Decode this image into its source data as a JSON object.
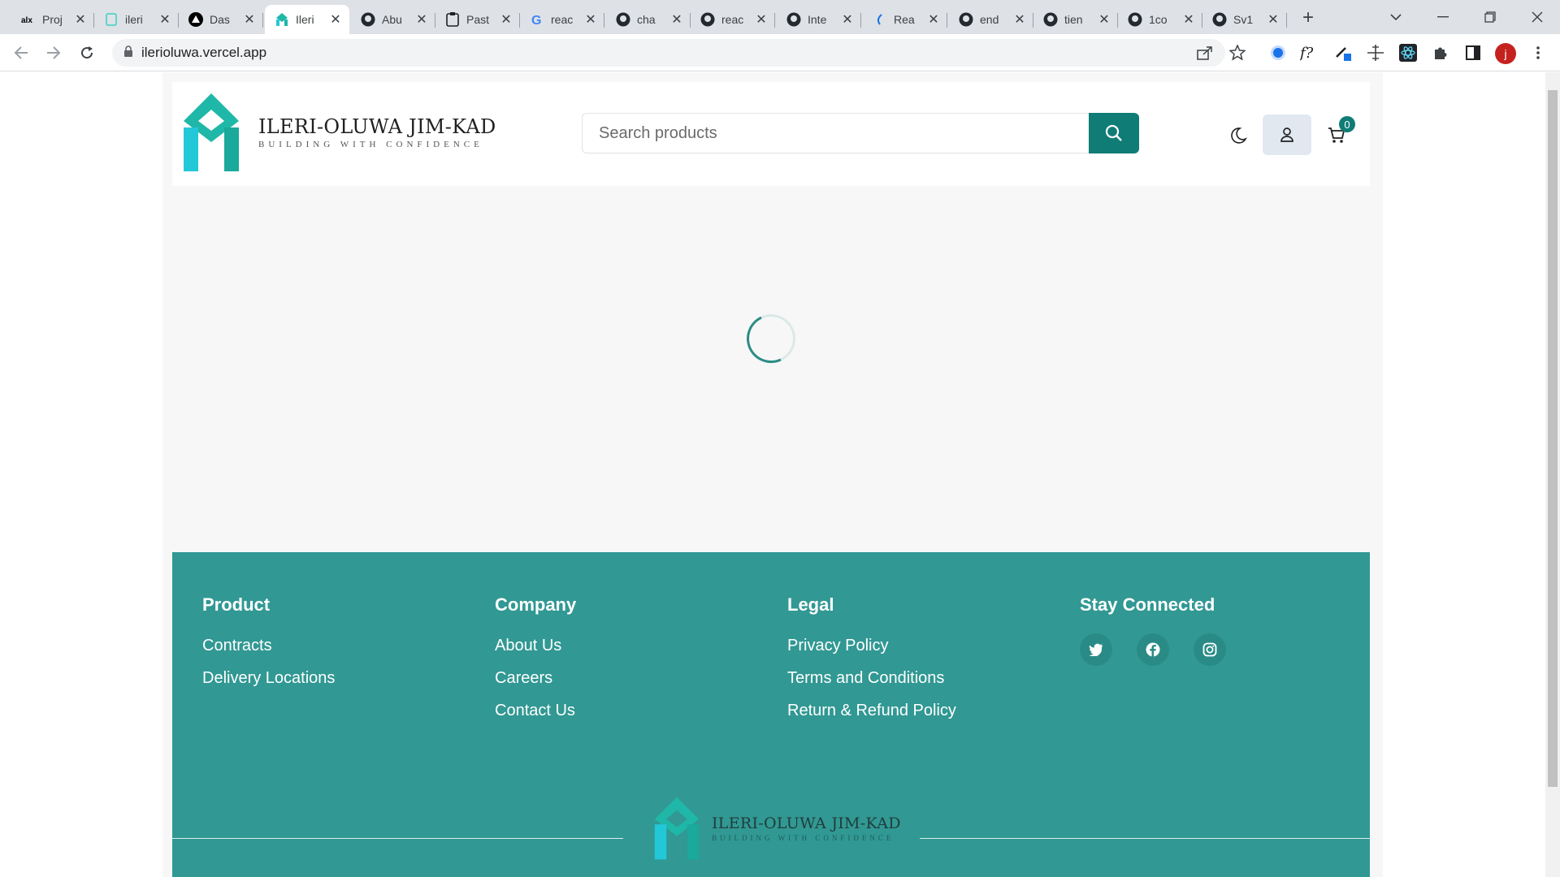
{
  "browser": {
    "tabs": [
      {
        "title": "Proj",
        "favicon": "alx-logo"
      },
      {
        "title": "ileri",
        "favicon": "page-icon"
      },
      {
        "title": "Das",
        "favicon": "vercel-icon"
      },
      {
        "title": "Ileri",
        "favicon": "ileri-logo",
        "active": true
      },
      {
        "title": "Abu",
        "favicon": "github-icon"
      },
      {
        "title": "Past",
        "favicon": "clipboard-icon"
      },
      {
        "title": "reac",
        "favicon": "google-icon"
      },
      {
        "title": "cha",
        "favicon": "github-icon"
      },
      {
        "title": "reac",
        "favicon": "github-icon"
      },
      {
        "title": "Inte",
        "favicon": "github-icon"
      },
      {
        "title": "Rea",
        "favicon": "react-icon"
      },
      {
        "title": "end",
        "favicon": "github-icon"
      },
      {
        "title": "tien",
        "favicon": "github-icon"
      },
      {
        "title": "1co",
        "favicon": "github-icon"
      },
      {
        "title": "Sv1",
        "favicon": "github-icon"
      }
    ],
    "url": "ilerioluwa.vercel.app",
    "profile_initial": "j"
  },
  "header": {
    "brand_name": "ILERI-OLUWA JIM-KAD",
    "brand_tagline": "BUILDING WITH CONFIDENCE",
    "search_placeholder": "Search products",
    "cart_count": "0"
  },
  "footer": {
    "columns": [
      {
        "heading": "Product",
        "links": [
          "Contracts",
          "Delivery Locations"
        ]
      },
      {
        "heading": "Company",
        "links": [
          "About Us",
          "Careers",
          "Contact Us"
        ]
      },
      {
        "heading": "Legal",
        "links": [
          "Privacy Policy",
          "Terms and Conditions",
          "Return & Refund Policy"
        ]
      },
      {
        "heading": "Stay Connected",
        "links": []
      }
    ],
    "social": [
      "twitter-icon",
      "facebook-icon",
      "instagram-icon"
    ],
    "brand_name": "ILERI-OLUWA JIM-KAD",
    "brand_tagline": "BUILDING WITH CONFIDENCE"
  },
  "colors": {
    "accent": "#0f7c76",
    "footer_bg": "#319893",
    "logo_teal": "#1fb7a8",
    "logo_cyan": "#23c8d8"
  }
}
